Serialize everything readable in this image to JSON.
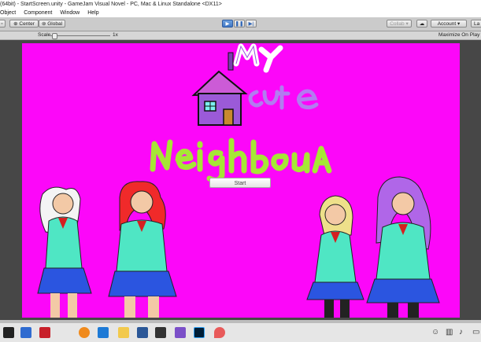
{
  "window": {
    "title": "(64bit) - StartScreen.unity - GameJam Visual Novel - PC, Mac & Linux Standalone <DX11>"
  },
  "menu": {
    "items": [
      "Object",
      "Component",
      "Window",
      "Help"
    ]
  },
  "toolbar": {
    "pivot_label": "Center",
    "space_label": "Global",
    "collab_label": "Collab",
    "account_label": "Account",
    "layers_label": "La"
  },
  "gameview": {
    "scale_label": "Scale",
    "scale_value": "1x",
    "maximize_label": "Maximize On Play"
  },
  "game": {
    "title_my": "My",
    "title_cute": "cute",
    "title_neighbour": "Neighboua",
    "start_label": "Start",
    "colors": {
      "background": "#fc07f9",
      "title_green": "#a6e636",
      "title_white": "#ffffff",
      "cute_purple": "#b27cf0"
    }
  },
  "taskbar": {
    "icons": [
      "windows-start-icon",
      "store-icon",
      "gift-icon",
      "firefox-icon",
      "edge-icon",
      "explorer-icon",
      "word-icon",
      "unity-icon",
      "visual-studio-icon",
      "photoshop-icon",
      "maps-icon",
      "people-icon",
      "network-icon",
      "sound-icon",
      "notifications-icon"
    ]
  }
}
